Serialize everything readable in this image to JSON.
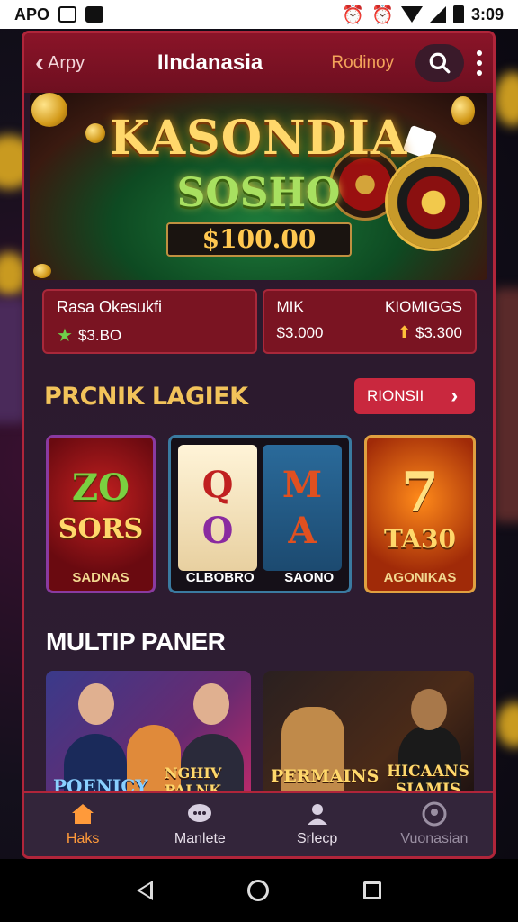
{
  "status_bar": {
    "left_text": "APO",
    "time": "3:09",
    "left_icons": [
      "photo-icon",
      "app-icon"
    ],
    "right_icons": [
      "alarm-icon",
      "alarm-icon",
      "wifi-icon",
      "signal-icon",
      "battery-icon"
    ]
  },
  "header": {
    "back_label": "Arpy",
    "title": "IIndanasia",
    "right_label": "Rodinoy"
  },
  "banner": {
    "line1": "KASONDIA",
    "line2": "SOSHO",
    "amount": "$100.00"
  },
  "promos": [
    {
      "title": "Rasa Okesukfi",
      "value": "$3.BO"
    },
    {
      "title_left": "MIK",
      "title_right": "KIOMIGGS",
      "value_left": "$3.000",
      "value_right": "$3.300"
    }
  ],
  "section1": {
    "title": "PRCNIK LAGIEK",
    "button_label": "RIONSII"
  },
  "games": [
    {
      "big1": "ZO",
      "big2": "SORS",
      "label": "SADNAS"
    },
    {
      "reel1": [
        "Q",
        "O"
      ],
      "reel2": [
        "M",
        "A"
      ],
      "label_left": "CLBOBRO",
      "label_right": "SAONO"
    },
    {
      "big1": "7",
      "big2": "TA30",
      "label": "AGONIKAS"
    }
  ],
  "section2": {
    "title": "MULTIP PANER"
  },
  "cards": [
    {
      "text1": "POENICY",
      "text2": "NGHIV PALNK"
    },
    {
      "text1": "PERMAINS",
      "text2": "HICAANS SIAMIS"
    }
  ],
  "nav": [
    {
      "label": "Haks",
      "icon": "home-icon",
      "active": true
    },
    {
      "label": "Manlete",
      "icon": "chat-icon"
    },
    {
      "label": "Srlecp",
      "icon": "user-icon"
    },
    {
      "label": "Vuonasian",
      "icon": "profile-icon"
    }
  ],
  "colors": {
    "accent": "#b0253a",
    "header": "#7a1422",
    "gold": "#f2c35a",
    "active_nav": "#ff9a3a"
  }
}
